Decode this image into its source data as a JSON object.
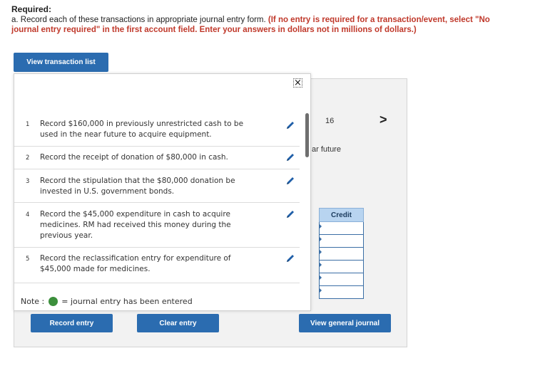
{
  "header": {
    "title": "Required:",
    "line1_prefix": "a. Record each of these transactions in appropriate journal entry form. ",
    "line1_red": "(If no entry is required for a transaction/event, select \"No",
    "line2_red": "journal entry required\" in the first account field. Enter your answers in dollars not in millions of dollars.)"
  },
  "buttons": {
    "view_transaction_list": "View transaction list",
    "record_entry": "Record entry",
    "clear_entry": "Clear entry",
    "view_general_journal": "View general journal"
  },
  "background_panel": {
    "transaction_number": "16",
    "description_fragment": "ar future",
    "next_symbol": ">",
    "credit_header": "Credit"
  },
  "popup": {
    "close_symbol": "×",
    "transactions": [
      {
        "number": "1",
        "text": "Record $160,000 in previously unrestricted cash to be used in the near future to acquire equipment."
      },
      {
        "number": "2",
        "text": "Record the receipt of donation of $80,000 in cash."
      },
      {
        "number": "3",
        "text": "Record the stipulation that the $80,000 donation be invested in U.S. government bonds."
      },
      {
        "number": "4",
        "text": "Record the $45,000 expenditure in cash to acquire medicines. RM had received this money during the previous year."
      },
      {
        "number": "5",
        "text": "Record the reclassification entry for expenditure of $45,000 made for medicines."
      }
    ],
    "note_label": "Note :",
    "note_text": "= journal entry has been entered"
  },
  "colors": {
    "button_blue": "#2b6cb0",
    "required_red": "#c0392b",
    "entered_green": "#3c8f3c",
    "credit_header_bg": "#b8d4f0"
  }
}
